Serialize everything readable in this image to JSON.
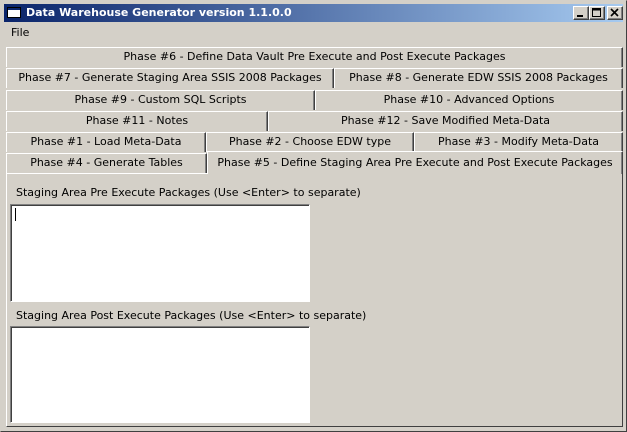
{
  "window": {
    "title": "Data Warehouse Generator version 1.1.0.0",
    "icon": "app-window-icon"
  },
  "menu": {
    "file": "File"
  },
  "tabs": {
    "row1": [
      {
        "label": "Phase #6 - Define Data Vault Pre Execute and Post Execute Packages"
      }
    ],
    "row2": [
      {
        "label": "Phase #7 - Generate Staging Area SSIS 2008 Packages"
      },
      {
        "label": "Phase #8 - Generate EDW SSIS 2008 Packages"
      }
    ],
    "row3": [
      {
        "label": "Phase #9 - Custom SQL Scripts"
      },
      {
        "label": "Phase #10 - Advanced Options"
      }
    ],
    "row4": [
      {
        "label": "Phase #11 - Notes"
      },
      {
        "label": "Phase #12 - Save Modified Meta-Data"
      }
    ],
    "row5": [
      {
        "label": "Phase #1 - Load Meta-Data"
      },
      {
        "label": "Phase #2 - Choose EDW type"
      },
      {
        "label": "Phase #3 - Modify Meta-Data"
      }
    ],
    "row6": [
      {
        "label": "Phase #4 - Generate Tables"
      },
      {
        "label": "Phase #5 - Define Staging Area Pre Execute and Post Execute Packages",
        "active": true
      }
    ]
  },
  "panel": {
    "pre_label": "Staging Area Pre Execute Packages (Use <Enter> to separate)",
    "pre_value": "",
    "post_label": "Staging Area Post Execute Packages (Use <Enter> to separate)",
    "post_value": ""
  }
}
